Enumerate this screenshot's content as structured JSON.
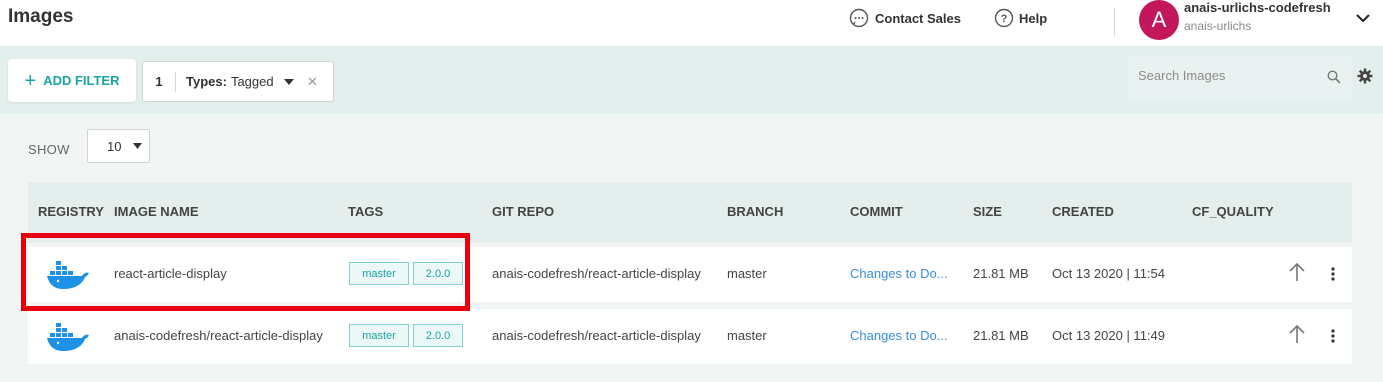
{
  "header": {
    "title": "Images",
    "contact_label": "Contact Sales",
    "help_label": "Help",
    "avatar_letter": "A",
    "account_name": "anais-urlichs-codefresh",
    "account_sub": "anais-urlichs"
  },
  "filters": {
    "add_label": "ADD FILTER",
    "chip": {
      "count": "1",
      "key": "Types:",
      "value": "Tagged"
    },
    "search_placeholder": "Search Images"
  },
  "pagination": {
    "show_label": "SHOW",
    "page_size": "10"
  },
  "table": {
    "columns": [
      "REGISTRY",
      "IMAGE NAME",
      "TAGS",
      "GIT REPO",
      "BRANCH",
      "COMMIT",
      "SIZE",
      "CREATED",
      "CF_QUALITY"
    ],
    "rows": [
      {
        "image_name": "react-article-display",
        "tags": [
          "master",
          "2.0.0"
        ],
        "git_repo": "anais-codefresh/react-article-display",
        "branch": "master",
        "commit": "Changes to Do...",
        "size": "21.81 MB",
        "created": "Oct 13 2020 | 11:54"
      },
      {
        "image_name": "anais-codefresh/react-article-display",
        "tags": [
          "master",
          "2.0.0"
        ],
        "git_repo": "anais-codefresh/react-article-display",
        "branch": "master",
        "commit": "Changes to Do...",
        "size": "21.81 MB",
        "created": "Oct 13 2020 | 11:49"
      }
    ]
  },
  "colors": {
    "accent": "#1ba3a3",
    "avatar": "#c2185b",
    "link": "#3a8fd6",
    "highlight": "#e8000b",
    "docker": "#1d91e6"
  }
}
